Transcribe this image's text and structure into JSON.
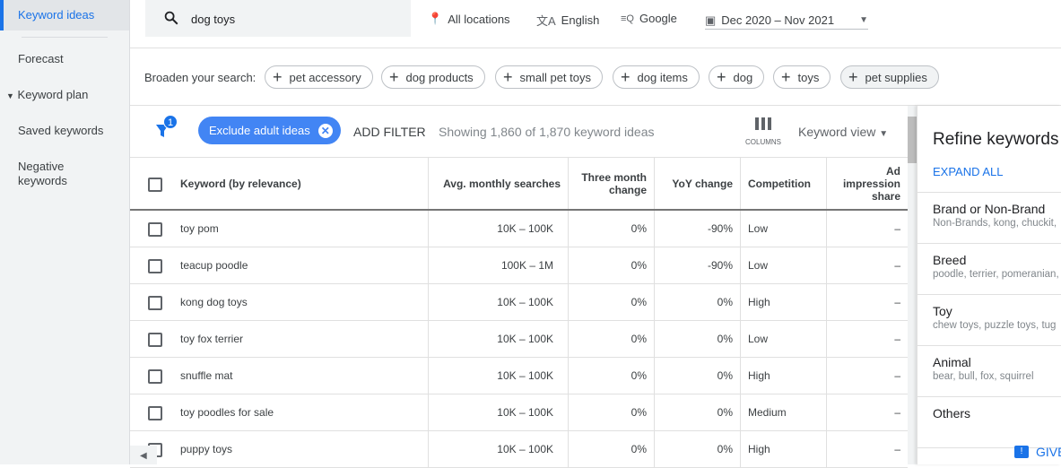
{
  "sidebar": {
    "items": [
      {
        "label": "Keyword ideas",
        "active": true
      },
      {
        "label": "Forecast"
      },
      {
        "label": "Keyword plan"
      },
      {
        "label": "Saved keywords"
      },
      {
        "label": "Negative keywords"
      }
    ]
  },
  "topbar": {
    "search_value": "dog toys",
    "location": "All locations",
    "language": "English",
    "network": "Google",
    "date_range": "Dec 2020 – Nov 2021"
  },
  "broaden": {
    "label": "Broaden your search:",
    "chips": [
      "pet accessory",
      "dog products",
      "small pet toys",
      "dog items",
      "dog",
      "toys",
      "pet supplies"
    ]
  },
  "filters": {
    "badge_count": "1",
    "active_filter": "Exclude adult ideas",
    "add_filter": "ADD FILTER",
    "showing": "Showing 1,860 of 1,870 keyword ideas",
    "columns_label": "COLUMNS",
    "view": "Keyword view"
  },
  "table": {
    "headers": [
      "Keyword (by relevance)",
      "Avg. monthly searches",
      "Three month change",
      "YoY change",
      "Competition",
      "Ad impression share"
    ],
    "rows": [
      [
        "toy pom",
        "10K – 100K",
        "0%",
        "-90%",
        "Low",
        "–"
      ],
      [
        "teacup poodle",
        "100K – 1M",
        "0%",
        "-90%",
        "Low",
        "–"
      ],
      [
        "kong dog toys",
        "10K – 100K",
        "0%",
        "0%",
        "High",
        "–"
      ],
      [
        "toy fox terrier",
        "10K – 100K",
        "0%",
        "0%",
        "Low",
        "–"
      ],
      [
        "snuffle mat",
        "10K – 100K",
        "0%",
        "0%",
        "High",
        "–"
      ],
      [
        "toy poodles for sale",
        "10K – 100K",
        "0%",
        "0%",
        "Medium",
        "–"
      ],
      [
        "puppy toys",
        "10K – 100K",
        "0%",
        "0%",
        "High",
        "–"
      ]
    ]
  },
  "refine": {
    "title": "Refine keywords",
    "expand_all": "EXPAND ALL",
    "groups": [
      {
        "title": "Brand or Non-Brand",
        "sub": "Non-Brands, kong, chuckit,"
      },
      {
        "title": "Breed",
        "sub": "poodle, terrier, pomeranian,"
      },
      {
        "title": "Toy",
        "sub": "chew toys, puzzle toys, tug"
      },
      {
        "title": "Animal",
        "sub": "bear, bull, fox, squirrel"
      },
      {
        "title": "Others",
        "sub": ""
      }
    ],
    "feedback": "GIVE"
  },
  "colors": {
    "accent": "#1a73e8",
    "chip_blue": "#4285f4"
  }
}
